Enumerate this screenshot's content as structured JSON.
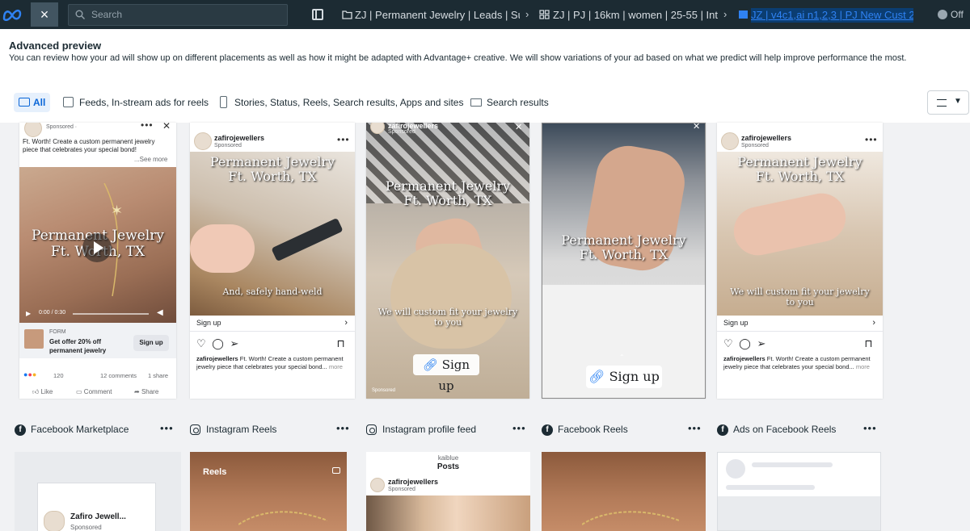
{
  "topbar": {
    "close_label": "×",
    "search_placeholder": "Search",
    "breadcrumbs": [
      "ZJ | Permanent Jewelry | Leads | Sur",
      "ZJ | PJ | 16km | women | 25-55 | Int t",
      "JZ | v4c1,ai n1,2,3 | PJ New Cust 20%"
    ],
    "status_label": "Off"
  },
  "header": {
    "title": "Advanced preview",
    "description": "You can review how your ad will show up on different placements as well as how it might be adapted with Advantage+ creative. We will show variations of your ad based on what we predict will help improve performance the most.",
    "filters": [
      {
        "label": "All",
        "selected": true
      },
      {
        "label": "Feeds, In-stream ads for reels",
        "selected": false
      },
      {
        "label": "Stories, Status, Reels, Search results, Apps and sites",
        "selected": false
      },
      {
        "label": "Search results",
        "selected": false
      }
    ]
  },
  "previews": {
    "fb_feed": {
      "sponsored": "Sponsored · ",
      "caption": "Ft. Worth! Create a custom permanent jewelry piece that celebrates your special bond!",
      "see_more": "...See more",
      "overlay_line1": "Permanent Jewelry",
      "overlay_line2": "Ft. Worth, TX",
      "time": "0:00 / 0:30",
      "cta_kind": "FORM",
      "cta_headline": "Get offer 20% off permanent jewelry",
      "cta_button": "Sign up",
      "reaction_count": "120",
      "comments": "12 comments",
      "shares": "1 share",
      "like": "Like",
      "comment": "Comment",
      "share": "Share"
    },
    "ig_feed_1": {
      "account": "zafirojewellers",
      "sponsored": "Sponsored",
      "overlay_line1": "Permanent Jewelry",
      "overlay_line2": "Ft. Worth, TX",
      "overlay_bottom": "And, safely hand-weld",
      "cta": "Sign up",
      "caption_account": "zafirojewellers",
      "caption": "Ft. Worth! Create a custom permanent jewelry piece that celebrates your special bond...",
      "more": "more"
    },
    "story_1": {
      "account": "zafirojewellers",
      "sponsored": "Sponsored",
      "overlay_line1": "Permanent Jewelry",
      "overlay_line2": "Ft. Worth, TX",
      "overlay_bottom1": "We will custom fit your jewelry",
      "overlay_bottom2": "to you",
      "cta": "Sign up",
      "footer": "Sponsored"
    },
    "story_2": {
      "overlay_line1": "Permanent Jewelry",
      "overlay_line2": "Ft. Worth, TX",
      "cta": "Sign up"
    },
    "ig_feed_2": {
      "account": "zafirojewellers",
      "sponsored": "Sponsored",
      "overlay_line1": "Permanent Jewelry",
      "overlay_line2": "Ft. Worth, TX",
      "overlay_bottom1": "We will custom fit your jewelry",
      "overlay_bottom2": "to you",
      "cta": "Sign up",
      "caption_account": "zafirojewellers",
      "caption": "Ft. Worth! Create a custom permanent jewelry piece that celebrates your special bond...",
      "more": "more"
    }
  },
  "sections": [
    {
      "icon": "facebook-icon",
      "label": "Facebook Marketplace"
    },
    {
      "icon": "instagram-icon",
      "label": "Instagram Reels"
    },
    {
      "icon": "instagram-icon",
      "label": "Instagram profile feed"
    },
    {
      "icon": "facebook-icon",
      "label": "Facebook Reels"
    },
    {
      "icon": "facebook-icon",
      "label": "Ads on Facebook Reels"
    }
  ],
  "bottom": {
    "marketplace_name": "Zafiro Jewell...",
    "marketplace_sponsored": "Sponsored",
    "reels_label": "Reels",
    "profile_handle": "kaiblue",
    "profile_posts": "Posts",
    "profile_account": "zafirojewellers",
    "profile_sponsored": "Sponsored"
  },
  "colors": {
    "topbar": "#1c2b33",
    "accent": "#0a66d8",
    "selected_bg": "#e6f0fc"
  }
}
